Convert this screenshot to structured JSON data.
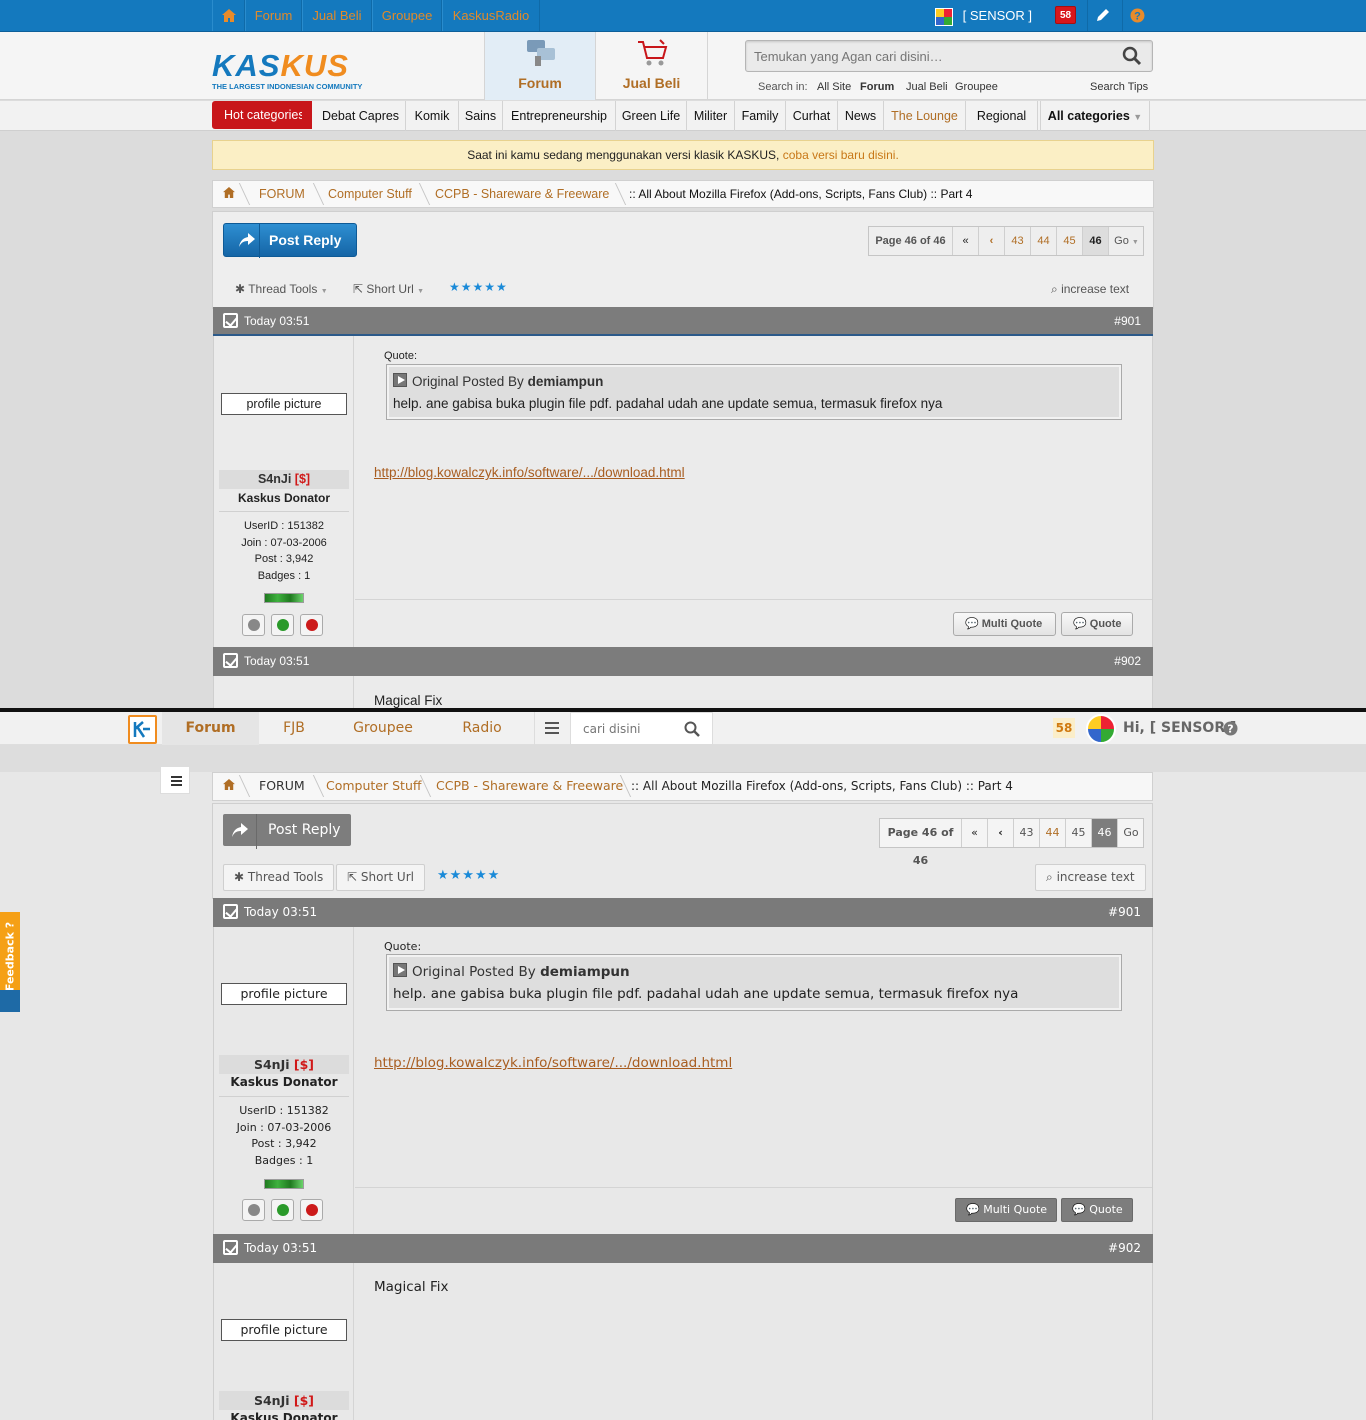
{
  "classic": {
    "topnav": {
      "items": [
        "Forum",
        "Jual Beli",
        "Groupee",
        "KaskusRadio"
      ],
      "user": "[ SENSOR ]",
      "notif_count": "58"
    },
    "logo": {
      "text_a": "KAS",
      "text_b": "KUS",
      "tagline": "THE LARGEST INDONESIAN COMMUNITY"
    },
    "tabs": {
      "forum": "Forum",
      "jualbeli": "Jual Beli"
    },
    "search": {
      "placeholder": "Temukan yang Agan cari disini…",
      "search_in_label": "Search in:",
      "scopes": [
        "All Site",
        "Forum",
        "Jual Beli",
        "Groupee"
      ],
      "tips": "Search Tips"
    },
    "categories": {
      "hot": "Hot categories",
      "items": [
        "Debat Capres",
        "Komik",
        "Sains",
        "Entrepreneurship",
        "Green Life",
        "Militer",
        "Family",
        "Curhat",
        "News",
        "The Lounge",
        "Regional"
      ],
      "all": "All categories"
    },
    "notice": {
      "text": "Saat ini kamu sedang menggunakan versi klasik KASKUS,",
      "link": "coba versi baru disini."
    }
  },
  "breadcrumb": [
    "FORUM",
    "Computer Stuff",
    "CCPB - Shareware & Freeware",
    ":: All About Mozilla Firefox (Add-ons, Scripts, Fans Club) :: Part 4"
  ],
  "thread": {
    "post_reply": "Post Reply",
    "pager": {
      "info": "Page 46 of 46",
      "pages": [
        "43",
        "44",
        "45",
        "46"
      ],
      "go": "Go"
    },
    "tools": {
      "thread_tools": "Thread Tools",
      "short_url": "Short Url",
      "increase_text": "increase text"
    }
  },
  "posts": [
    {
      "time": "Today 03:51",
      "num": "#901",
      "profile_picture": "profile picture",
      "username": "S4nJi",
      "donor_tag": "[$]",
      "role": "Kaskus Donator",
      "userid": "UserID : 151382",
      "join": "Join    : 07-03-2006",
      "post": "Post    : 3,942",
      "badges": "Badges : 1",
      "quote_label": "Quote:",
      "quote_author_prefix": "Original Posted By",
      "quote_author": "demiampun",
      "quote_text": "help. ane gabisa buka plugin file pdf. padahal udah ane update semua, termasuk firefox nya",
      "link": "http://blog.kowalczyk.info/software/.../download.html",
      "multi_quote": "Multi Quote",
      "quote_btn": "Quote"
    },
    {
      "time": "Today 03:51",
      "num": "#902",
      "profile_picture": "profile picture",
      "username": "S4nJi",
      "donor_tag": "[$]",
      "role": "Kaskus Donator",
      "body": "Magical Fix"
    }
  ],
  "modern": {
    "tabs": [
      "Forum",
      "FJB",
      "Groupee",
      "Radio"
    ],
    "search_placeholder": "cari disini",
    "notif_count": "58",
    "greeting": "Hi, [ SENSOR ]",
    "feedback": "Feedback ?"
  },
  "colors": {
    "accent_blue": "#1479be",
    "accent_orange": "#b06e25",
    "hot_red": "#c8161a",
    "post_header": "#7c7c7c"
  }
}
